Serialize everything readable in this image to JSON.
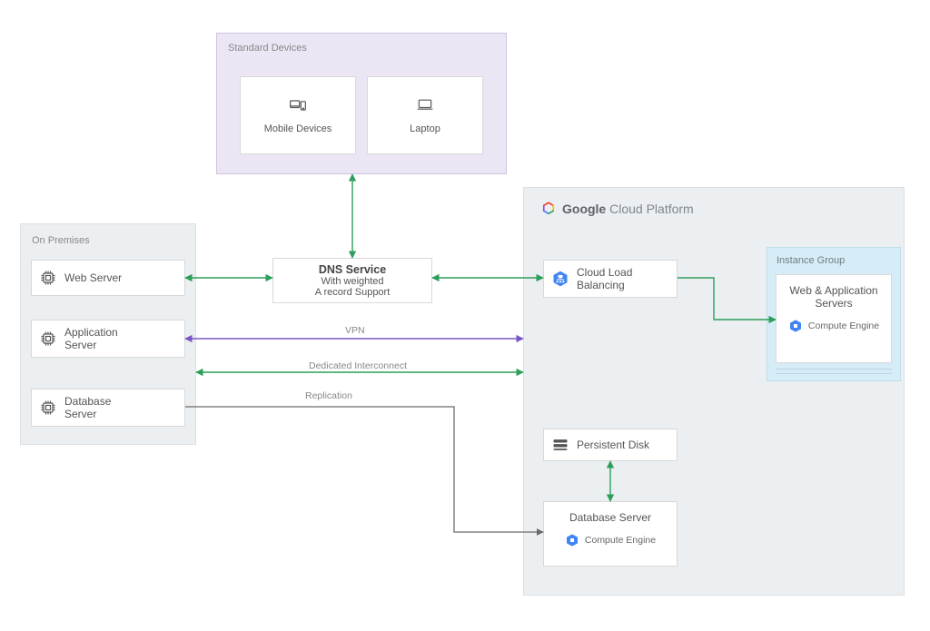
{
  "regions": {
    "devices": {
      "title": "Standard Devices"
    },
    "onprem": {
      "title": "On Premises"
    },
    "gcp": {
      "title_prefix": "Google",
      "title_suffix": "Cloud Platform"
    },
    "instance_group": {
      "title": "Instance Group"
    }
  },
  "nodes": {
    "mobile": {
      "label": "Mobile Devices",
      "icon": "devices-icon"
    },
    "laptop": {
      "label": "Laptop",
      "icon": "laptop-icon"
    },
    "dns": {
      "title": "DNS Service",
      "line2": "With weighted",
      "line3": "A record Support"
    },
    "web_server": {
      "label": "Web Server",
      "icon": "chip-icon"
    },
    "app_server": {
      "label1": "Application",
      "label2": "Server",
      "icon": "chip-icon"
    },
    "db_server_onprem": {
      "label1": "Database",
      "label2": "Server",
      "icon": "chip-icon"
    },
    "cloud_lb": {
      "label1": "Cloud Load",
      "label2": "Balancing",
      "icon": "load-balancer-icon"
    },
    "persistent_disk": {
      "label": "Persistent Disk",
      "icon": "disk-icon"
    },
    "db_server_cloud": {
      "label": "Database Server",
      "ce_label": "Compute Engine",
      "ce_icon": "compute-engine-icon"
    },
    "web_app_servers": {
      "label1": "Web & Application",
      "label2": "Servers",
      "ce_label": "Compute Engine",
      "ce_icon": "compute-engine-icon"
    }
  },
  "edges": {
    "vpn": {
      "label": "VPN",
      "color": "#7a55c7"
    },
    "interconnect": {
      "label": "Dedicated Interconnect",
      "color": "#2e9e5b"
    },
    "replication": {
      "label": "Replication",
      "color": "#6b6b6b"
    }
  },
  "colors": {
    "green": "#2e9e5b",
    "purple": "#7a55c7",
    "gray": "#6b6b6b",
    "blue_icon": "#3b7ddd"
  }
}
